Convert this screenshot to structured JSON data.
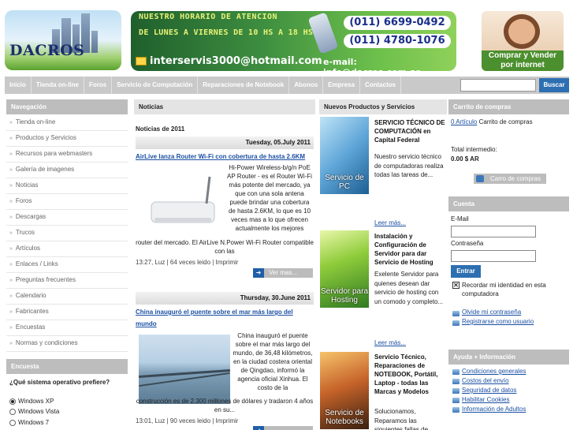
{
  "header": {
    "logo_text": "DACROS",
    "banner": {
      "hours_line1": "NUESTRO HORARIO DE ATENCION",
      "hours_line2": "DE LUNES A VIERNES DE 10 HS A 18 HS",
      "phone1": "(011) 6699-0492",
      "phone2": "(011) 4780-1076",
      "email_personal": "interservis3000@hotmail.com",
      "email_company": "e-mail: info@dacros.com.ar"
    },
    "promo_caption": "Comprar y Vender por internet"
  },
  "nav": {
    "items": [
      "Inicio",
      "Tienda on-line",
      "Foros",
      "Servicio de Computación",
      "Reparaciones de Notebook",
      "Abonos",
      "Empresa",
      "Contactos"
    ],
    "search_button": "Buscar"
  },
  "left": {
    "nav_title": "Navegación",
    "nav_items": [
      "Tienda on-line",
      "Productos y Servicios",
      "Recursos para webmasters",
      "Galería de imagenes",
      "Noticias",
      "Foros",
      "Descargas",
      "Trucos",
      "Artículos",
      "Enlaces / Links",
      "Preguntas frecuentes",
      "Calendario",
      "Fabricantes",
      "Encuestas",
      "Normas y condiciones"
    ],
    "poll_title": "Encuesta",
    "poll_question": "¿Qué sistema operativo prefiere?",
    "poll_options": [
      "Windows XP",
      "Windows Vista",
      "Windows 7"
    ]
  },
  "news": {
    "title": "Noticias",
    "subtitle": "Noticias de 2011",
    "items": [
      {
        "date": "Tuesday, 05.July 2011",
        "headline": "AirLive lanza Router Wi-Fi con cobertura de hasta 2.6KM",
        "body_side": "Hi-Power Wireless-b/g/n PoE AP Router - es el Router Wi-Fi más potente del mercado, ya que con una sola antena puede brindar una cobertura de hasta 2.6KM, lo que es 10 veces mas a lo que ofrecen actualmente los mejores",
        "body_full": "router del mercado. El AirLive N.Power Wi-Fi Router compatible con las",
        "meta": "13:27,   Luz  |  64 veces leido | Imprimir",
        "more": "Ver mas..."
      },
      {
        "date": "Thursday, 30.June 2011",
        "headline": "China inauguró el puente sobre el mar más largo del mundo",
        "body_side": "China inauguró el puente sobre el mar más largo del mundo, de 36,48 kilómetros, en la ciudad costera oriental de Qingdao, informó la agencia oficial Xinhua. El costo de la",
        "body_full": "construcción es de 2.300 millones de dólares y tradaron 4 años en su...",
        "meta": "13:01,   Luz  |  90 veces leido | Imprimir"
      }
    ]
  },
  "products": {
    "title": "Nuevos Productos y Servicios",
    "items": [
      {
        "image_caption": "Servicio de PC",
        "title": "SERVICIO TÉCNICO DE COMPUTACIÓN en Capital Federal",
        "desc": "Nuestro servicio técnico de computadoras realiza todas las tareas de...",
        "more": "Leer más..."
      },
      {
        "image_caption": "Servidor para Hosting",
        "title": "Instalación y Configuración de Servidor para dar Servicio de Hosting",
        "desc": "Exelente Servidor para quienes desean dar servicio de hosting con un comodo y completo...",
        "more": "Leer más..."
      },
      {
        "image_caption": "Servicio de Notebooks",
        "title": "Servicio Técnico, Reparaciones de NOTEBOOK, Portátil, Laptop - todas las Marcas y Modelos",
        "desc": "Solucionamos, Reparamos las siguientes fallas de"
      }
    ]
  },
  "cart": {
    "title": "Carrito de compras",
    "articles_link": "0 Artículo",
    "articles_label": "Carrito de compras",
    "subtotal_label": "Intermedio: ",
    "subtotal_prefix": "Total intermedio:",
    "subtotal_value": "0.00 $ AR",
    "button": "Carro de compras"
  },
  "account": {
    "title": "Cuenta",
    "email_label": "E-Mail",
    "password_label": "Contraseña",
    "login_button": "Entrar",
    "remember_label": "Recordar mi identidad en esta computadora",
    "forgot_link": "Olvide mi contraseña",
    "register_link": "Registrarse como usuario"
  },
  "help": {
    "title": "Ayuda + Información",
    "links": [
      "Condiciones generales",
      "Costos del envío",
      "Seguridad de datos",
      "Habilitar Cookies",
      "Información de Adultos"
    ]
  },
  "colors": {
    "accent_blue": "#2d6fb1",
    "link_blue": "#1a4fa3",
    "header_gray": "#bdbdbd"
  }
}
